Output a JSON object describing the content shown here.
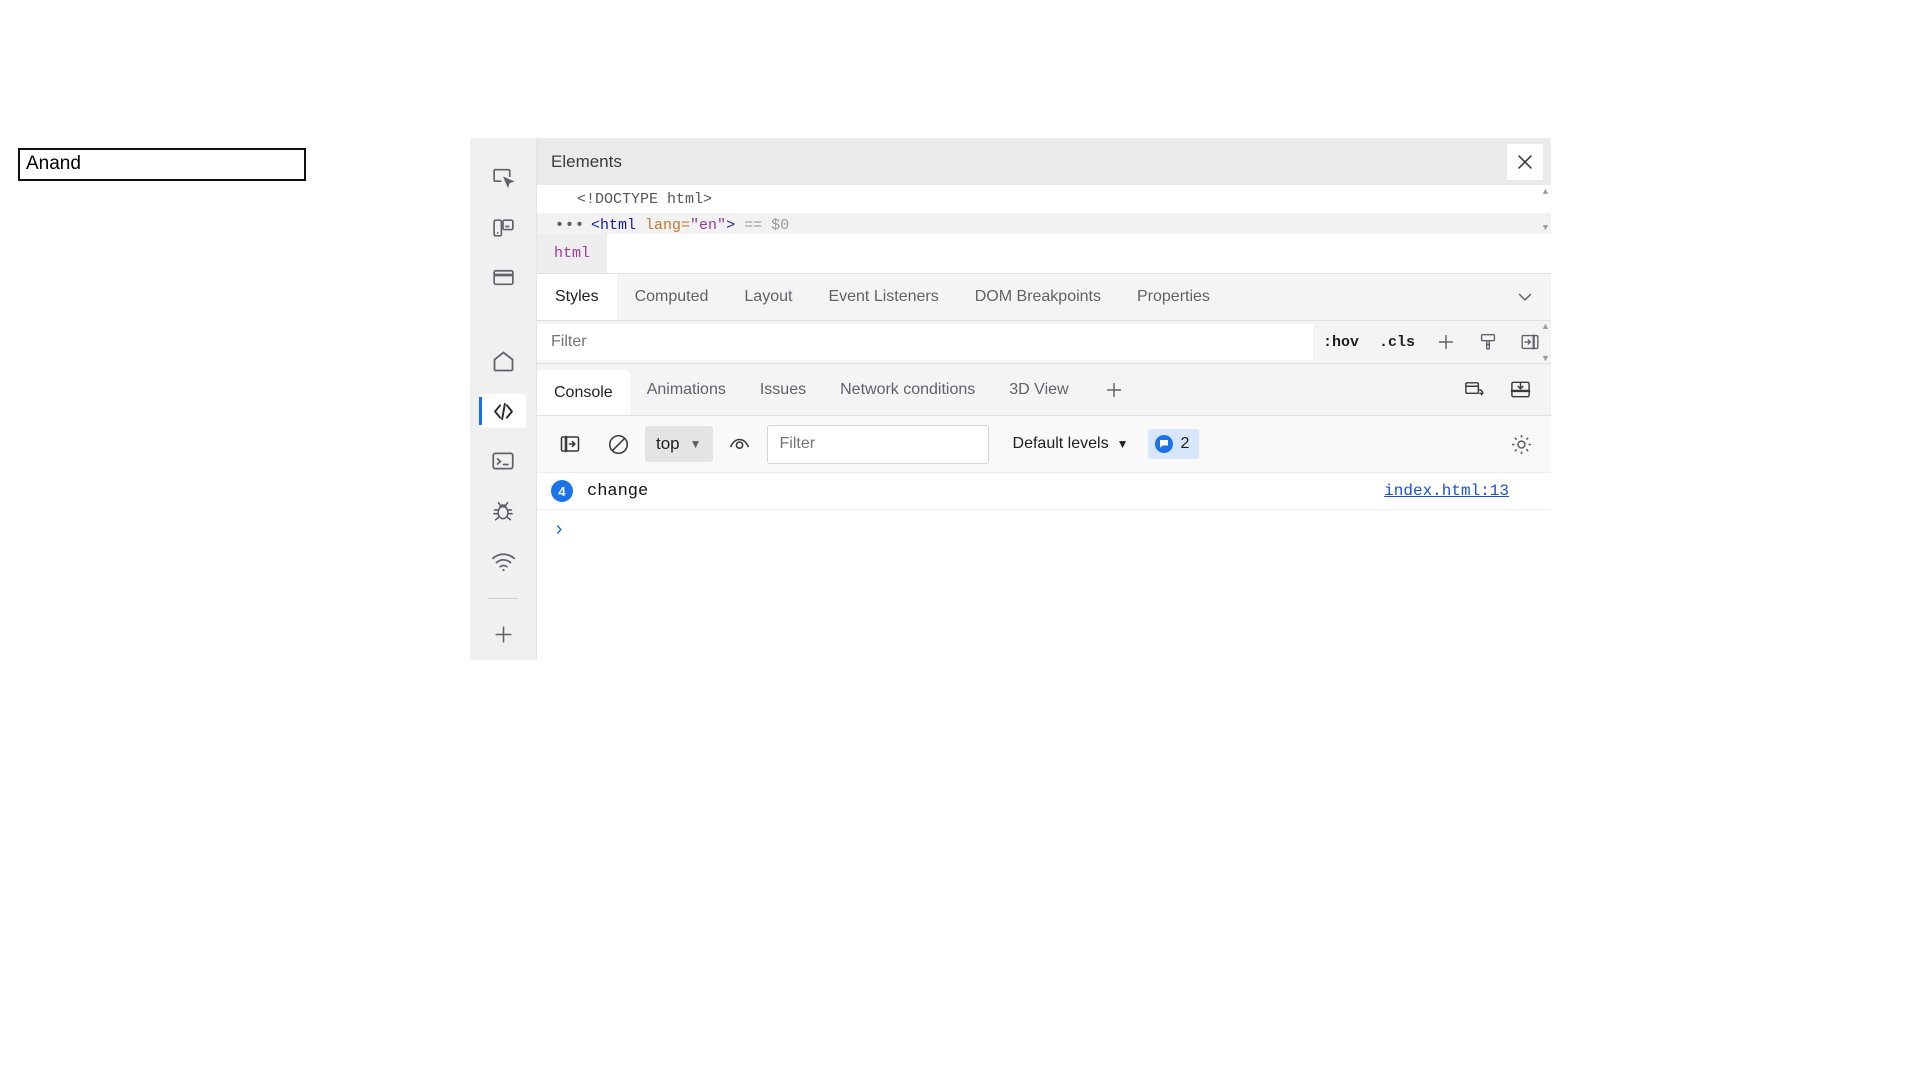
{
  "page": {
    "name_input_value": "Anand",
    "name_input_placeholder": ""
  },
  "devtools": {
    "activity_bar": {
      "items": [
        {
          "icon": "inspect-element-icon",
          "active": false
        },
        {
          "icon": "device-toolbar-icon",
          "active": false
        },
        {
          "icon": "window-icon",
          "active": false
        },
        {
          "icon": "home-icon",
          "active": false
        },
        {
          "icon": "elements-code-icon",
          "active": true
        },
        {
          "icon": "console-terminal-icon",
          "active": false
        },
        {
          "icon": "debugger-bug-icon",
          "active": false
        },
        {
          "icon": "network-wifi-icon",
          "active": false
        },
        {
          "icon": "add-tool-icon",
          "active": false
        }
      ]
    },
    "elements_panel": {
      "title": "Elements",
      "close_label": "✕",
      "dom_rows": [
        {
          "ellipsis": "",
          "text": "<!DOCTYPE html>",
          "selected": false
        },
        {
          "ellipsis": "•••",
          "tag_open": "<html",
          "attr_name": " lang=",
          "attr_value": "\"en\"",
          "tag_close": ">",
          "suffix": " == $0",
          "selected": true
        }
      ],
      "breadcrumb": [
        "html"
      ]
    },
    "styles_pane": {
      "tabs": [
        {
          "label": "Styles",
          "active": true
        },
        {
          "label": "Computed",
          "active": false
        },
        {
          "label": "Layout",
          "active": false
        },
        {
          "label": "Event Listeners",
          "active": false
        },
        {
          "label": "DOM Breakpoints",
          "active": false
        },
        {
          "label": "Properties",
          "active": false
        }
      ],
      "more_tabs_icon": "chevron-down-icon",
      "filter_placeholder": "Filter",
      "filter_value": "",
      "hov_label": ":hov",
      "cls_label": ".cls",
      "new_style_rule_icon": "plus-icon",
      "computed_styles_icon": "paintbrush-icon",
      "open_sidebar_icon": "panel-right-icon"
    },
    "console_panel": {
      "tabs": [
        {
          "label": "Console",
          "active": true
        },
        {
          "label": "Animations",
          "active": false
        },
        {
          "label": "Issues",
          "active": false
        },
        {
          "label": "Network conditions",
          "active": false
        },
        {
          "label": "3D View",
          "active": false
        }
      ],
      "add_tab_icon": "plus-icon",
      "dock_icons": [
        "device-dock-icon",
        "dock-bottom-icon"
      ],
      "toolbar": {
        "sidebar_toggle_icon": "show-console-sidebar-icon",
        "clear_console_icon": "clear-console-icon",
        "context_value": "top",
        "context_caret": "▼",
        "live_expression_icon": "eye-icon",
        "filter_placeholder": "Filter",
        "filter_value": "",
        "levels_label": "Default levels",
        "levels_caret": "▼",
        "info_count": "2",
        "info_icon": "message-icon",
        "settings_icon": "gear-icon"
      },
      "messages": [
        {
          "count": "4",
          "text": "change",
          "source": "index.html:13"
        }
      ],
      "prompt": "›"
    }
  },
  "colors": {
    "accent_purple": "#8a3ab9",
    "accent_blue": "#1a73e8",
    "link_blue": "#1a4fd6",
    "tag_blue": "#1a1aa6",
    "attr_orange": "#c8782e",
    "breadcrumb_purple": "#a0399c",
    "panel_gray": "#f4f4f4"
  }
}
